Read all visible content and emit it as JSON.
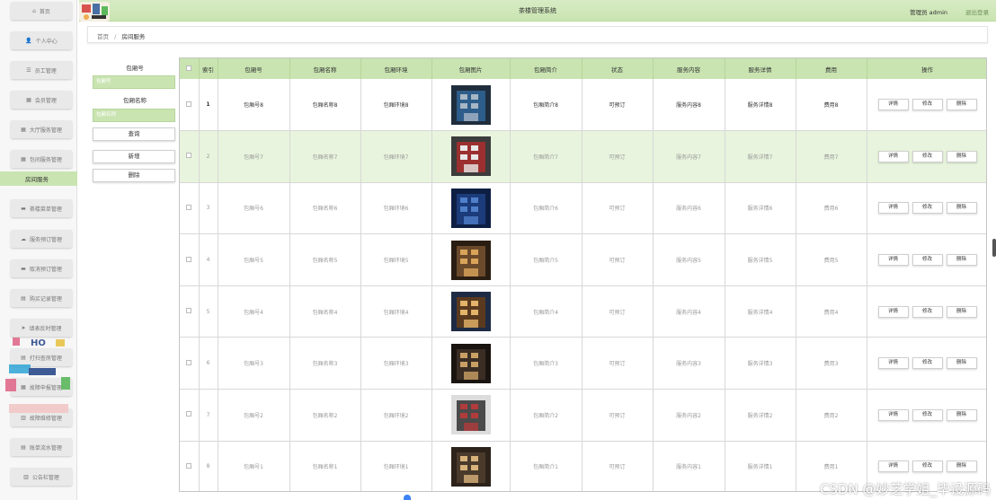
{
  "header": {
    "title": "茶楼管理系统",
    "user": "管理员 admin",
    "logout": "退出登录"
  },
  "sidebar": {
    "items": [
      {
        "label": "首页",
        "icon": "home-icon",
        "glyph": "⌂"
      },
      {
        "label": "个人中心",
        "icon": "user-icon",
        "glyph": "👤"
      },
      {
        "label": "员工管理",
        "icon": "list-icon",
        "glyph": "☰"
      },
      {
        "label": "会员管理",
        "icon": "grid-icon",
        "glyph": "▦"
      },
      {
        "label": "大厅服务管理",
        "icon": "grid-icon",
        "glyph": "▦"
      },
      {
        "label": "包间服务管理",
        "icon": "grid-icon",
        "glyph": "▦"
      },
      {
        "label": "茶楼菜单管理",
        "icon": "chat-icon",
        "glyph": "▬"
      },
      {
        "label": "服务预订管理",
        "icon": "cloud-icon",
        "glyph": "☁"
      },
      {
        "label": "取消预订管理",
        "icon": "chat-icon",
        "glyph": "▬"
      },
      {
        "label": "购买记录管理",
        "icon": "doc-icon",
        "glyph": "▤"
      },
      {
        "label": "填表反时管理",
        "icon": "send-icon",
        "glyph": "➤"
      },
      {
        "label": "打扫查房管理",
        "icon": "doc-icon",
        "glyph": "▤"
      },
      {
        "label": "故障申报管理",
        "icon": "grid-icon",
        "glyph": "▦"
      },
      {
        "label": "故障维修管理",
        "icon": "chart-icon",
        "glyph": "▥"
      },
      {
        "label": "账单流水管理",
        "icon": "doc-icon",
        "glyph": "▤"
      },
      {
        "label": "公告栏管理",
        "icon": "chart-icon",
        "glyph": "▥"
      }
    ],
    "active_sub": "房间服务"
  },
  "breadcrumb": {
    "home": "首页",
    "current": "房间服务"
  },
  "search": {
    "label1": "包厢号",
    "placeholder1": "包厢号",
    "label2": "包厢名称",
    "placeholder2": "包厢名称",
    "query_btn": "查询",
    "add_btn": "新增",
    "delete_btn": "删除"
  },
  "table": {
    "headers": [
      "索引",
      "包厢号",
      "包厢名称",
      "包厢环境",
      "包厢图片",
      "包厢简介",
      "状态",
      "服务内容",
      "服务详情",
      "费用",
      "操作"
    ],
    "op_labels": {
      "detail": "详情",
      "edit": "修改",
      "delete": "删除"
    },
    "rows": [
      {
        "index": "1",
        "room_no": "包厢号8",
        "name": "包厢名称8",
        "env": "包厢环境8",
        "intro": "包厢简介8",
        "status": "可预订",
        "content": "服务内容8",
        "detail": "服务详情8",
        "fee": "费用8"
      },
      {
        "index": "2",
        "room_no": "包厢号7",
        "name": "包厢名称7",
        "env": "包厢环境7",
        "intro": "包厢简介7",
        "status": "可预订",
        "content": "服务内容7",
        "detail": "服务详情7",
        "fee": "费用7"
      },
      {
        "index": "3",
        "room_no": "包厢号6",
        "name": "包厢名称6",
        "env": "包厢环境6",
        "intro": "包厢简介6",
        "status": "可预订",
        "content": "服务内容6",
        "detail": "服务详情6",
        "fee": "费用6"
      },
      {
        "index": "4",
        "room_no": "包厢号5",
        "name": "包厢名称5",
        "env": "包厢环境5",
        "intro": "包厢简介5",
        "status": "可预订",
        "content": "服务内容5",
        "detail": "服务详情5",
        "fee": "费用5"
      },
      {
        "index": "5",
        "room_no": "包厢号4",
        "name": "包厢名称4",
        "env": "包厢环境4",
        "intro": "包厢简介4",
        "status": "可预订",
        "content": "服务内容4",
        "detail": "服务详情4",
        "fee": "费用4"
      },
      {
        "index": "6",
        "room_no": "包厢号3",
        "name": "包厢名称3",
        "env": "包厢环境3",
        "intro": "包厢简介3",
        "status": "可预订",
        "content": "服务内容3",
        "detail": "服务详情3",
        "fee": "费用3"
      },
      {
        "index": "7",
        "room_no": "包厢号2",
        "name": "包厢名称2",
        "env": "包厢环境2",
        "intro": "包厢简介2",
        "status": "可预订",
        "content": "服务内容2",
        "detail": "服务详情2",
        "fee": "费用2"
      },
      {
        "index": "8",
        "room_no": "包厢号1",
        "name": "包厢名称1",
        "env": "包厢环境1",
        "intro": "包厢简介1",
        "status": "可预订",
        "content": "服务内容1",
        "detail": "服务详情1",
        "fee": "费用1"
      }
    ]
  },
  "watermark": "CSDN @妙芝学姐_毕设源码",
  "colors": {
    "accent": "#c9e4b1",
    "highlight_row": "#e8f4dd",
    "sidebar_active": "#c9e4b1"
  }
}
